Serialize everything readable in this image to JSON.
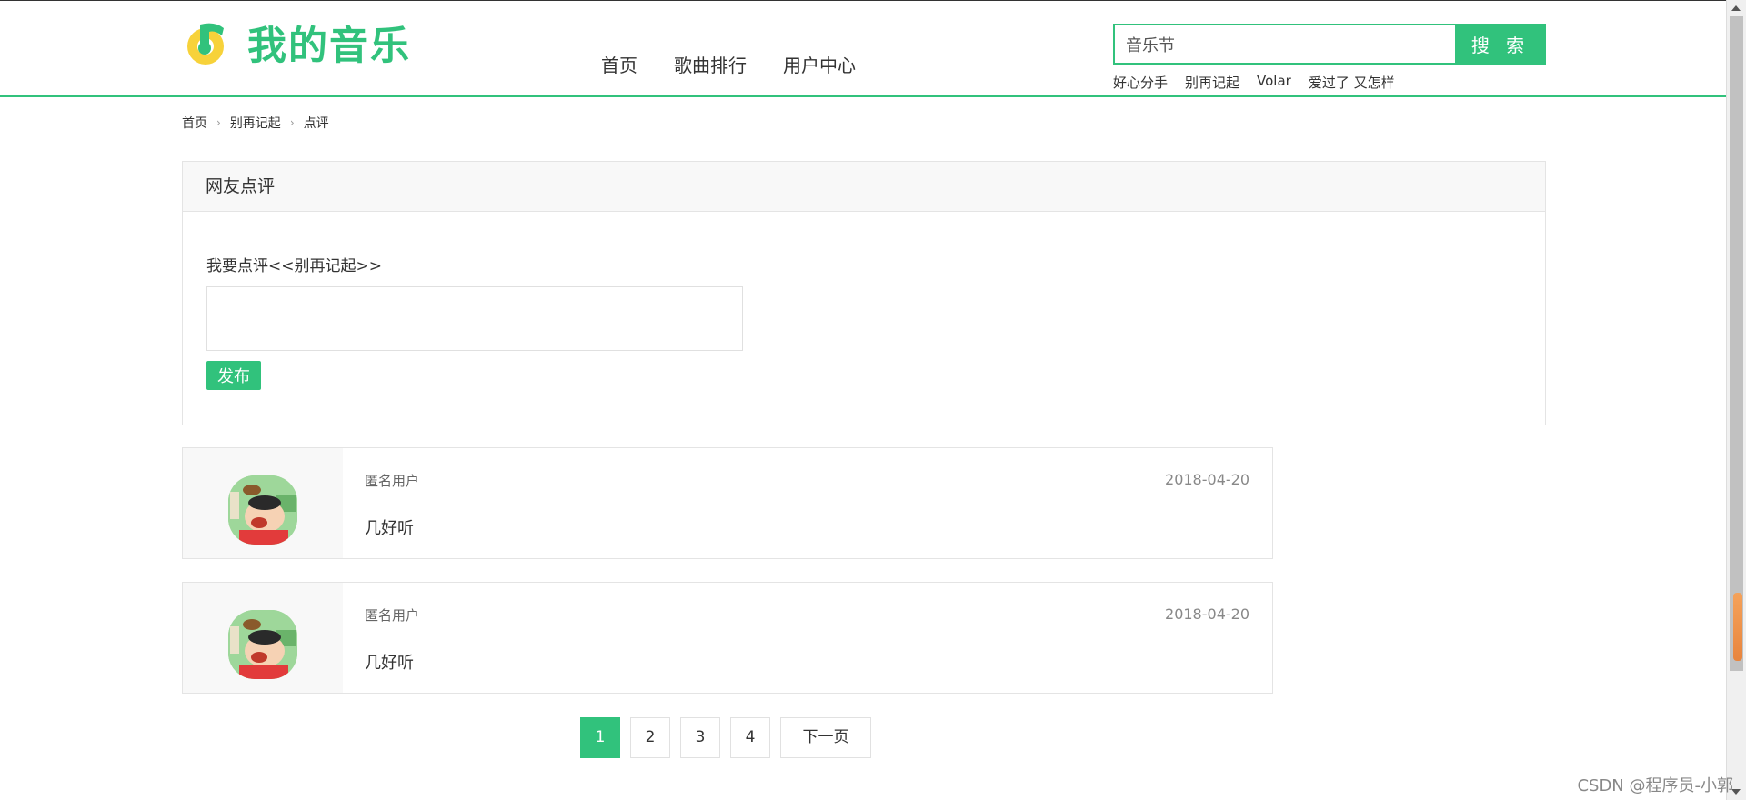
{
  "header": {
    "logo_text": "我的音乐",
    "nav": [
      "首页",
      "歌曲排行",
      "用户中心"
    ],
    "search": {
      "value": "音乐节",
      "button_label": "搜 索"
    },
    "hotwords": [
      "好心分手",
      "别再记起",
      "Volar",
      "爱过了 又怎样"
    ]
  },
  "breadcrumb": [
    "首页",
    "别再记起",
    "点评"
  ],
  "comment_panel": {
    "title": "网友点评",
    "prompt": "我要点评<<别再记起>>",
    "publish_label": "发布"
  },
  "comments": [
    {
      "user": "匿名用户",
      "date": "2018-04-20",
      "text": "几好听"
    },
    {
      "user": "匿名用户",
      "date": "2018-04-20",
      "text": "几好听"
    }
  ],
  "pagination": {
    "pages": [
      "1",
      "2",
      "3",
      "4"
    ],
    "active": "1",
    "next_label": "下一页"
  },
  "watermark": "CSDN @程序员-小郭",
  "colors": {
    "accent": "#31c27c"
  }
}
